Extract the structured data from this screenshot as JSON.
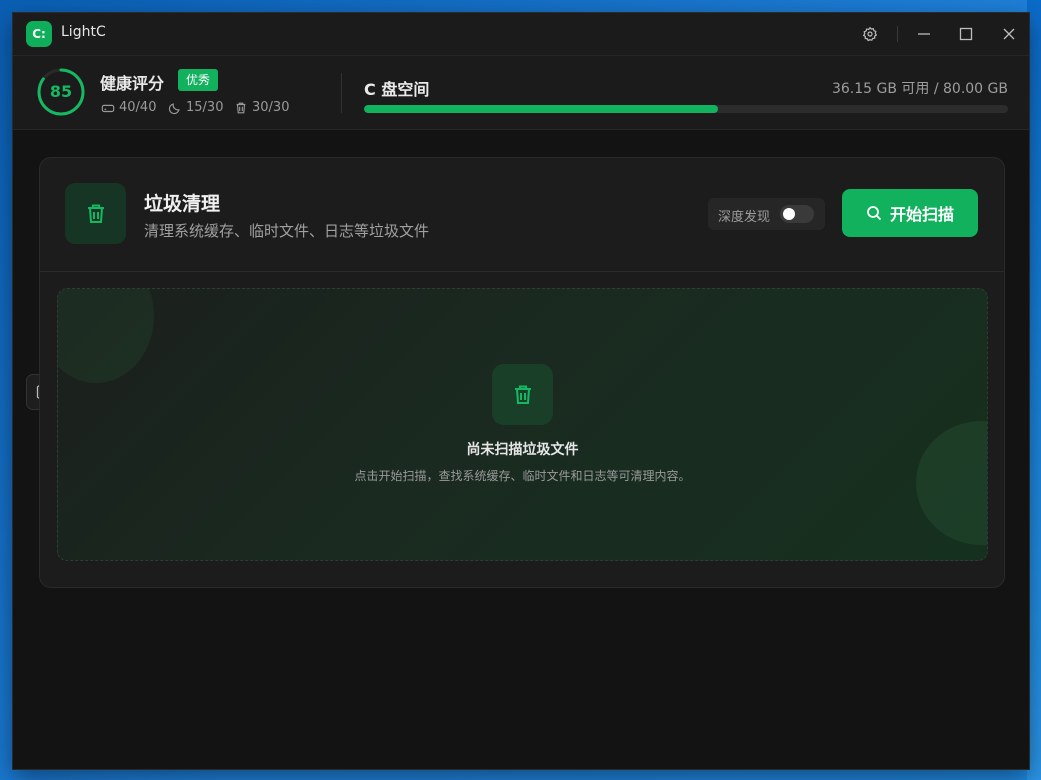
{
  "app": {
    "logo_text": "C:",
    "title": "LightC"
  },
  "titlebar": {
    "settings_icon": "gear-icon",
    "minimize_icon": "minimize-icon",
    "maximize_icon": "maximize-icon",
    "close_icon": "close-icon"
  },
  "health": {
    "score": "85",
    "score_fraction": 0.85,
    "label": "健康评分",
    "badge": "优秀",
    "metrics": [
      {
        "icon": "drive-icon",
        "value": "40/40"
      },
      {
        "icon": "moon-icon",
        "value": "15/30"
      },
      {
        "icon": "trash-icon",
        "value": "30/30"
      }
    ]
  },
  "disk": {
    "title": "C 盘空间",
    "info": "36.15 GB 可用 / 80.00 GB",
    "used_fraction": 0.55
  },
  "card": {
    "title": "垃圾清理",
    "subtitle": "清理系统缓存、临时文件、日志等垃圾文件",
    "deep_label": "深度发现",
    "deep_enabled": false,
    "scan_label": "开始扫描",
    "empty_title": "尚未扫描垃圾文件",
    "empty_desc": "点击开始扫描，查找系统缓存、临时文件和日志等可清理内容。"
  },
  "colors": {
    "accent": "#11b15e",
    "background": "#131313",
    "card": "#1c1c1c"
  }
}
